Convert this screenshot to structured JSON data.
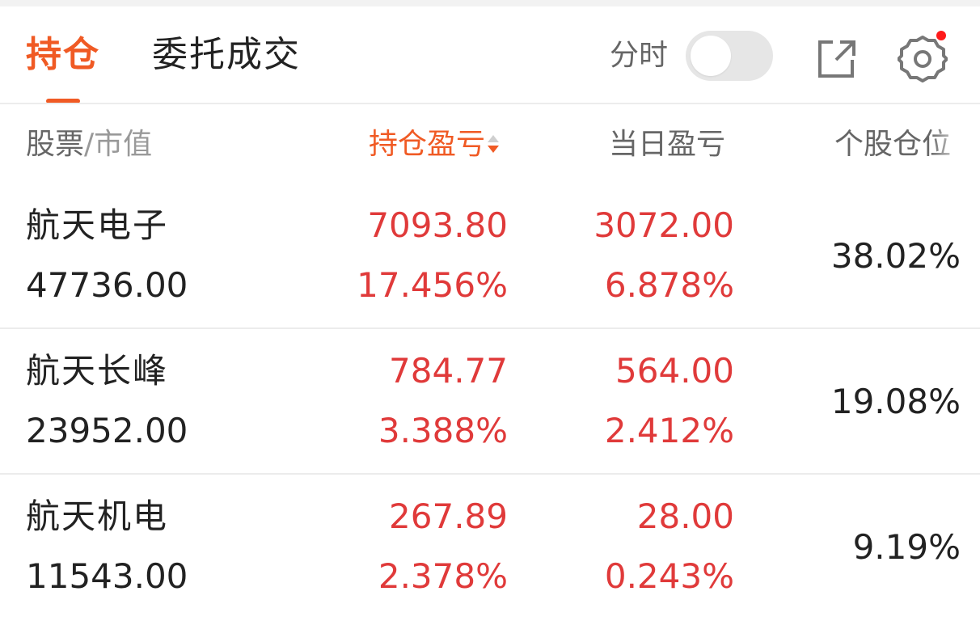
{
  "tabs": {
    "holdings": "持仓",
    "orders": "委托成交"
  },
  "header": {
    "timeshare_label": "分时",
    "timeshare_on": false,
    "settings_has_notification": true,
    "accent_color": "#f05a24",
    "notification_color": "#ff1a1a"
  },
  "columns": {
    "stock": "股票",
    "slash": "/",
    "market_value": "市值",
    "holding_pnl": "持仓盈亏",
    "day_pnl": "当日盈亏",
    "position": "个股仓位"
  },
  "rows": [
    {
      "name": "航天电子",
      "market_value": "47736.00",
      "holding_pnl": "7093.80",
      "holding_pnl_pct": "17.456%",
      "day_pnl": "3072.00",
      "day_pnl_pct": "6.878%",
      "position": "38.02%"
    },
    {
      "name": "航天长峰",
      "market_value": "23952.00",
      "holding_pnl": "784.77",
      "holding_pnl_pct": "3.388%",
      "day_pnl": "564.00",
      "day_pnl_pct": "2.412%",
      "position": "19.08%"
    },
    {
      "name": "航天机电",
      "market_value": "11543.00",
      "holding_pnl": "267.89",
      "holding_pnl_pct": "2.378%",
      "day_pnl": "28.00",
      "day_pnl_pct": "0.243%",
      "position": "9.19%"
    }
  ],
  "gain_color": "#e03a3a"
}
